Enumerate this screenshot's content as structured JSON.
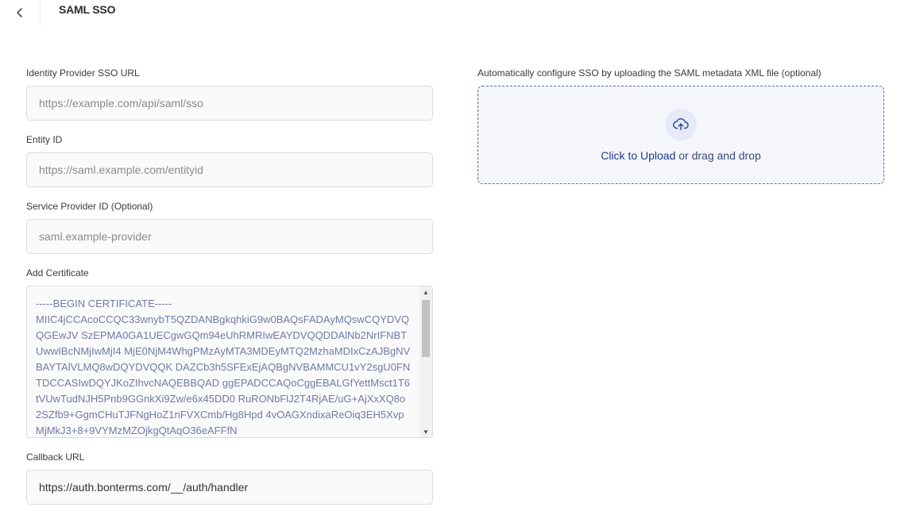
{
  "header": {
    "title": "SAML SSO",
    "back_icon": "chevron-left-icon"
  },
  "form": {
    "idp_url": {
      "label": "Identity Provider SSO URL",
      "placeholder": "https://example.com/api/saml/sso",
      "value": ""
    },
    "entity_id": {
      "label": "Entity ID",
      "placeholder": "https://saml.example.com/entityid",
      "value": ""
    },
    "sp_id": {
      "label": "Service Provider ID (Optional)",
      "placeholder": "saml.example-provider",
      "value": ""
    },
    "certificate": {
      "label": "Add Certificate",
      "text": "-----BEGIN CERTIFICATE-----\nMIIC4jCCAcoCCQC33wnybT5QZDANBgkqhkiG9w0BAQsFADAyMQswCQYDVQQGEwJV SzEPMA0GA1UECgwGQm94eUhRMRIwEAYDVQQDDAlNb2NrIFNBTUwwIBcNMjIwMjI4 MjE0NjM4WhgPMzAyMTA3MDEyMTQ2MzhaMDIxCzAJBgNVBAYTAlVLMQ8wDQYDVQQK DAZCb3h5SFExEjAQBgNVBAMMCU1vY2sgU0FNTDCCASIwDQYJKoZIhvcNAQEBBQAD ggEPADCCAQoCggEBALGfYettMsct1T6tVUwTudNJH5Pnb9GGnkXi9Zw/e6x45DD0 RuRONbFlJ2T4RjAE/uG+AjXxXQ8o2SZfb9+GgmCHuTJFNgHoZ1nFVXCmb/Hg8Hpd 4vOAGXndixaReOiq3EH5XvpMjMkJ3+8+9VYMzMZOjkgQtAqO36eAFFfN"
    },
    "callback_url": {
      "label": "Callback URL",
      "value": "https://auth.bonterms.com/__/auth/handler"
    }
  },
  "upload": {
    "label": "Automatically configure SSO by uploading the SAML metadata XML file (optional)",
    "link_text": "Click to Upload",
    "rest_text": " or drag and drop",
    "icon": "cloud-upload-icon"
  },
  "colors": {
    "accent": "#1f3a8a",
    "dropzone_border": "#5a6ea8",
    "dropzone_bg": "#f4f6fb"
  }
}
